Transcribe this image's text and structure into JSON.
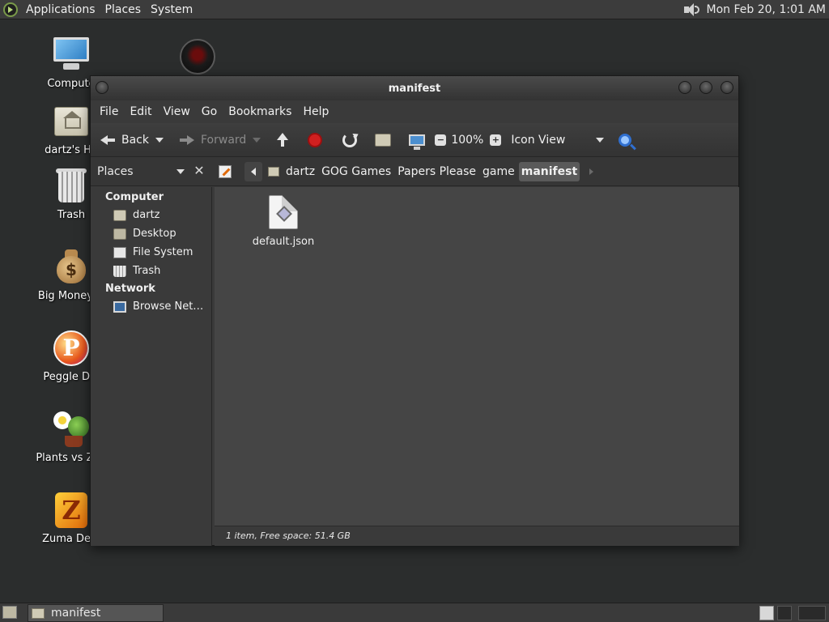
{
  "top_panel": {
    "menus": [
      "Applications",
      "Places",
      "System"
    ],
    "clock": "Mon Feb 20,  1:01 AM"
  },
  "desktop_icons": [
    {
      "label": "Compute",
      "icon": "computer-icon"
    },
    {
      "label": "dartz's Ho",
      "icon": "home-folder-icon"
    },
    {
      "label": "Trash",
      "icon": "trash-icon"
    },
    {
      "label": "Big Money D",
      "icon": "money-bag-icon"
    },
    {
      "label": "Peggle Del",
      "icon": "peggle-icon"
    },
    {
      "label": "Plants vs Zon",
      "icon": "plants-vs-zombies-icon"
    },
    {
      "label": "Zuma Delu",
      "icon": "zuma-icon"
    }
  ],
  "window": {
    "title": "manifest",
    "menu": [
      "File",
      "Edit",
      "View",
      "Go",
      "Bookmarks",
      "Help"
    ],
    "toolbar": {
      "back": "Back",
      "forward": "Forward",
      "zoom": "100%",
      "view_mode": "Icon View"
    },
    "location": {
      "places_label": "Places",
      "crumbs": [
        "dartz",
        "GOG Games",
        "Papers Please",
        "game",
        "manifest"
      ],
      "active_crumb": "manifest"
    },
    "sidebar": {
      "computer_header": "Computer",
      "computer_items": [
        "dartz",
        "Desktop",
        "File System",
        "Trash"
      ],
      "network_header": "Network",
      "network_items": [
        "Browse Net…"
      ]
    },
    "files": [
      {
        "name": "default.json",
        "icon": "json-file-icon"
      }
    ],
    "status": "1 item, Free space: 51.4 GB"
  },
  "taskbar": {
    "tasks": [
      "manifest"
    ]
  }
}
